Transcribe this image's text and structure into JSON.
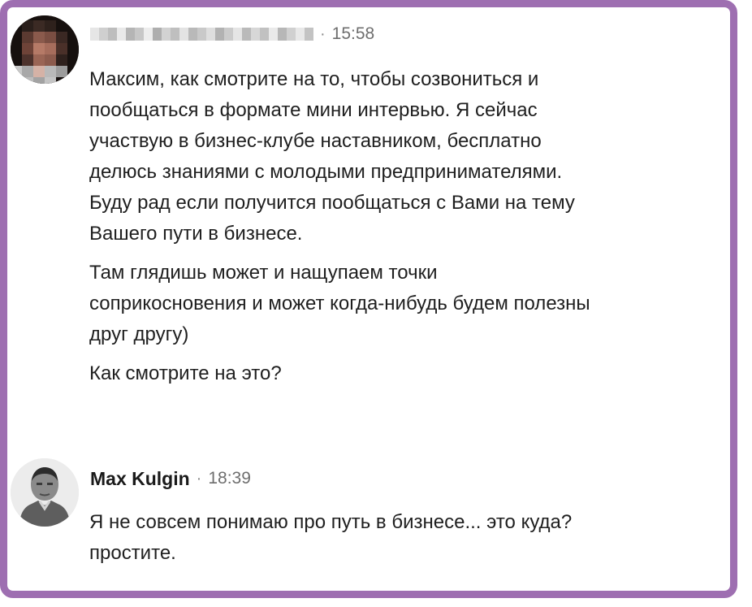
{
  "messages": [
    {
      "sender": "",
      "time": "15:58",
      "avatar_icon": "pixelated-avatar-icon",
      "paragraphs": [
        "Максим, как смотрите на то, чтобы созвониться и\nпообщаться в формате мини интервью. Я сейчас\nучаствую в бизнес-клубе наставником, бесплатно\nделюсь знаниями с молодыми предпринимателями.\nБуду рад если получится пообщаться с Вами на тему\nВашего пути в бизнесе.",
        "Там глядишь может и нащупаем точки\nсоприкосновения и может когда-нибудь будем полезны\nдруг другу)",
        "Как смотрите на это?"
      ]
    },
    {
      "sender": "Max Kulgin",
      "time": "18:39",
      "avatar_icon": "user-photo-avatar-icon",
      "paragraphs": [
        "Я не совсем понимаю про путь в бизнесе... это куда?\nпростите."
      ]
    }
  ],
  "colors": {
    "frame_border": "#9e6fb1",
    "text": "#1f1f1f",
    "muted": "#6e6e6e"
  }
}
